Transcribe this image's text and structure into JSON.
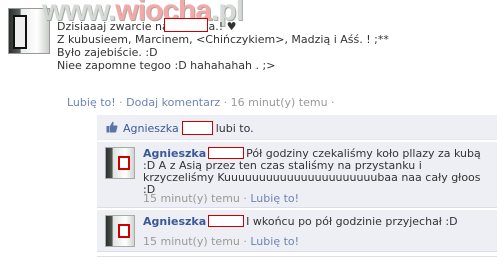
{
  "watermark": {
    "text_1": "www.",
    "text_2": "wiocha",
    "text_3": ".pl"
  },
  "post": {
    "lines": [
      "Dzisiaaaj zwarcie na maksaa.! ♥",
      "Z kubusieem, Marcinem, <Chińczykiem>, Madzią i Aśś. ! ;**",
      "Było zajebiście. :D",
      "Niee zapomne tegoo :D hahahahah . ;>"
    ],
    "like_label": "Lubię to!",
    "comment_label": "Dodaj komentarz",
    "separator": " · ",
    "time": "16 minut(y) temu ·"
  },
  "likes": {
    "name": "Agnieszka",
    "suffix": "lubi to."
  },
  "comments": [
    {
      "author": "Agnieszka",
      "text": "Pół godziny czekaliśmy koło pllazy za kubą :D A z Asią przez ten czas staliśmy na przystanku i krzyczeliśmy Kuuuuuuuuuuuuuuuuuuuuuubaa naa cały głoos :D",
      "time": "15 minut(y) temu ·",
      "like_label": "Lubię to!"
    },
    {
      "author": "Agnieszka",
      "text": "I wkońcu po pół godzinie przyjechał :D",
      "time": "15 minut(y) temu ·",
      "like_label": "Lubię to!"
    }
  ],
  "colors": {
    "link": "#3b5998",
    "meta_link": "#6d84b4",
    "ufi_bg": "#edeff4",
    "redaction": "#cc0000"
  },
  "icons": [
    "thumbs-up-icon"
  ]
}
